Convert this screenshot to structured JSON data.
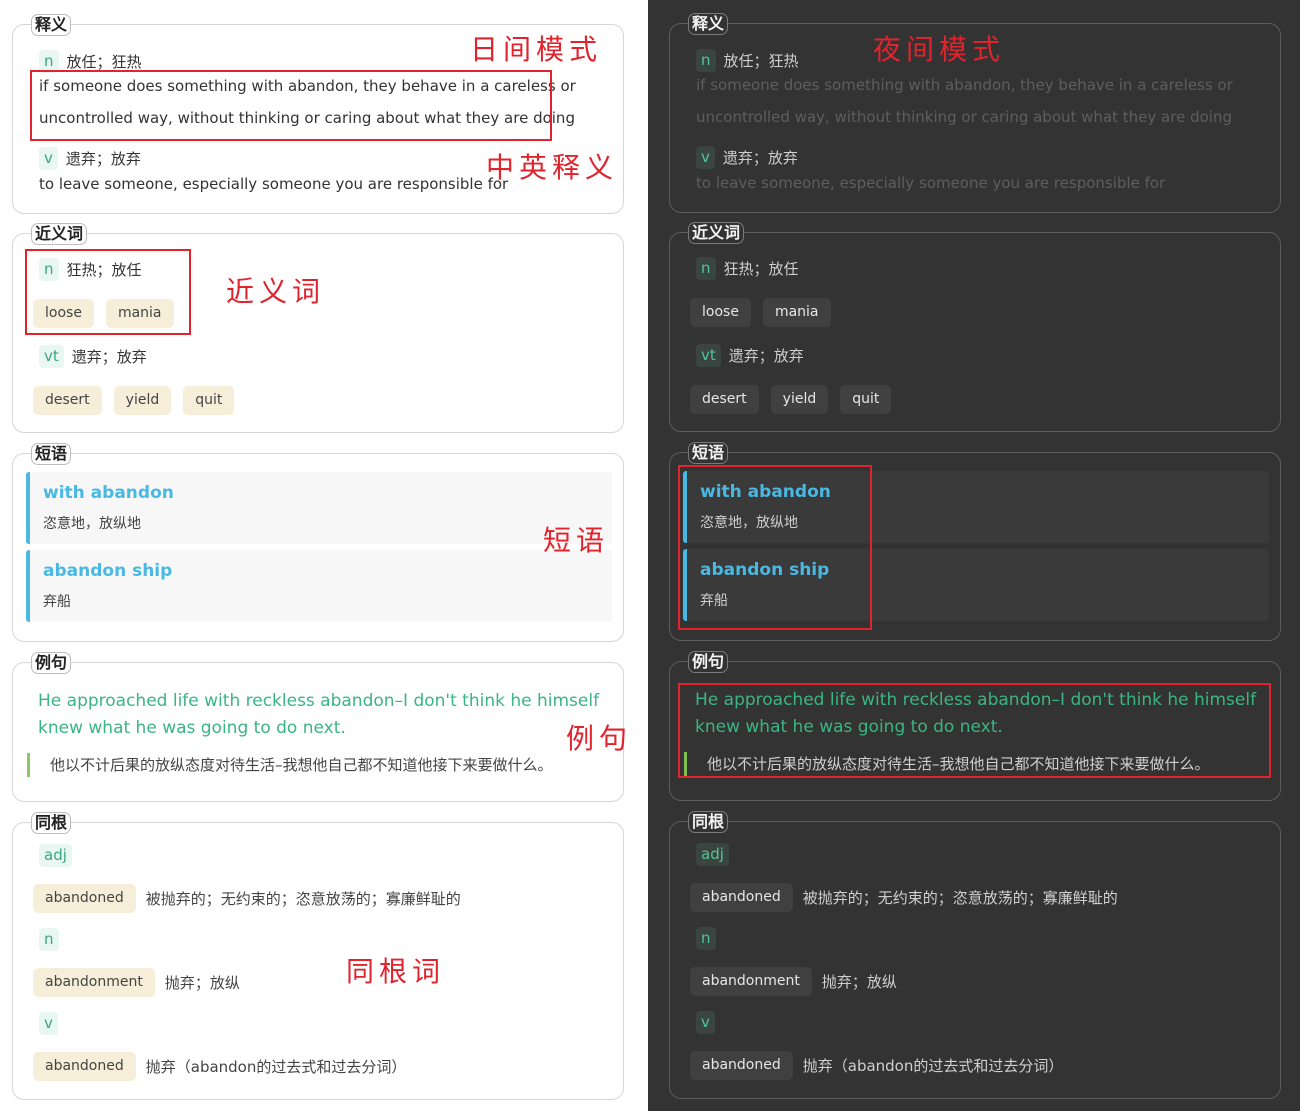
{
  "labels": {
    "definition": "释义",
    "synonyms": "近义词",
    "phrases": "短语",
    "examples": "例句",
    "cognates": "同根"
  },
  "definitions": [
    {
      "pos": "n",
      "zh": "放任；狂热",
      "en_line1": "if someone does something with abandon, they behave in a careless or",
      "en_line2": "uncontrolled way, without thinking or caring about what they are doing"
    },
    {
      "pos": "v",
      "zh": "遗弃；放弃",
      "en_line1": "to leave someone, especially someone you are responsible for"
    }
  ],
  "synonyms": [
    {
      "pos": "n",
      "zh": "狂热；放任",
      "words": [
        "loose",
        "mania"
      ]
    },
    {
      "pos": "vt",
      "zh": "遗弃；放弃",
      "words": [
        "desert",
        "yield",
        "quit"
      ]
    }
  ],
  "phrases": [
    {
      "en": "with abandon",
      "zh": "恣意地，放纵地"
    },
    {
      "en": "abandon ship",
      "zh": "弃船"
    }
  ],
  "example": {
    "en": "He approached life with reckless abandon–I don't think he himself knew what he was going to do next.",
    "zh": "他以不计后果的放纵态度对待生活–我想他自己都不知道他接下来要做什么。"
  },
  "cognates": [
    {
      "pos": "adj",
      "word": "abandoned",
      "zh": "被抛弃的；无约束的；恣意放荡的；寡廉鲜耻的"
    },
    {
      "pos": "n",
      "word": "abandonment",
      "zh": "抛弃；放纵"
    },
    {
      "pos": "v",
      "word": "abandoned",
      "zh": "抛弃（abandon的过去式和过去分词）"
    }
  ],
  "annotations": {
    "day_mode": "日间模式",
    "night_mode": "夜间模式",
    "bilingual": "中英释义",
    "synonyms": "近义词",
    "phrases": "短语",
    "examples": "例句",
    "cognates": "同根词"
  },
  "colors": {
    "accent_blue": "#49b9e3",
    "accent_green": "#3ab585",
    "pos_tag": "#52c49a",
    "annotation_red": "#e0242e",
    "dark_bg": "#333333"
  }
}
